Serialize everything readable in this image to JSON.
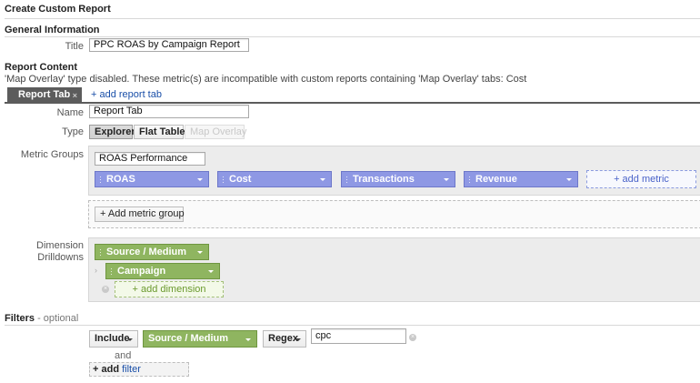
{
  "page": {
    "title": "Create Custom Report"
  },
  "general": {
    "heading": "General Information",
    "title_label": "Title",
    "title_value": "PPC ROAS by Campaign Report"
  },
  "content": {
    "heading": "Report Content",
    "warning": "'Map Overlay' type disabled. These metric(s) are incompatible with custom reports containing 'Map Overlay' tabs: Cost",
    "tab_label": "Report Tab",
    "tab_close": "×",
    "add_tab": "+ add report tab",
    "name_label": "Name",
    "name_value": "Report Tab",
    "type_label": "Type",
    "types": [
      "Explorer",
      "Flat Table",
      "Map Overlay"
    ],
    "metric_groups_label": "Metric Groups",
    "metric_group_name": "ROAS Performance",
    "metrics": [
      "ROAS",
      "Cost",
      "Transactions",
      "Revenue"
    ],
    "add_metric": "+ add metric",
    "add_metric_group": "+ Add metric group",
    "dimension_label_1": "Dimension",
    "dimension_label_2": "Drilldowns",
    "dimensions": [
      "Source / Medium",
      "Campaign"
    ],
    "add_dimension": "+ add dimension"
  },
  "filters": {
    "heading": "Filters",
    "optional": " - optional",
    "include": "Include",
    "dimension": "Source / Medium",
    "match": "Regex",
    "value": "cpc",
    "and": "and",
    "add_prefix": "+ add ",
    "add_word": "filter"
  },
  "colors": {
    "metric_blue": "#8e98e4",
    "dimension_green": "#8fb560",
    "link_blue": "#1a4fa8"
  }
}
